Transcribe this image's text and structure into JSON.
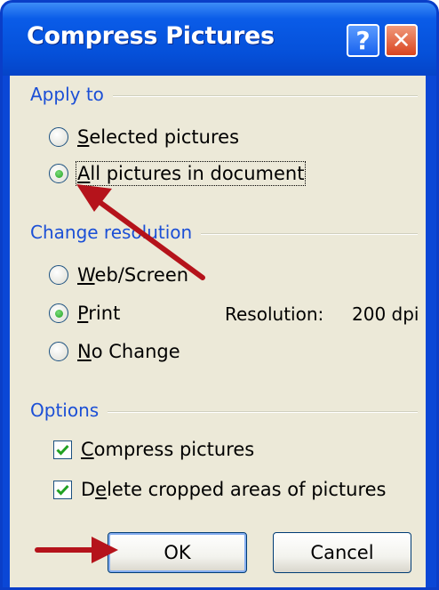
{
  "title_bar": {
    "title": "Compress Pictures",
    "help_label": "?",
    "close_label": "✕"
  },
  "apply_to": {
    "label": "Apply to",
    "options": [
      {
        "label": "Selected pictures",
        "mnemonic": "S",
        "rest": "elected pictures",
        "selected": false
      },
      {
        "label": "All pictures in document",
        "mnemonic": "A",
        "rest": "ll pictures in document",
        "selected": true
      }
    ]
  },
  "change_resolution": {
    "label": "Change resolution",
    "options": [
      {
        "label": "Web/Screen",
        "mnemonic": "W",
        "rest": "eb/Screen",
        "selected": false
      },
      {
        "label": "Print",
        "mnemonic": "P",
        "rest": "rint",
        "selected": true
      },
      {
        "label": "No Change",
        "mnemonic": "N",
        "rest": "o Change",
        "selected": false
      }
    ],
    "resolution_label": "Resolution:",
    "resolution_value": "200 dpi"
  },
  "options": {
    "label": "Options",
    "checkboxes": [
      {
        "label": "Compress pictures",
        "mnemonic": "C",
        "rest": "ompress pictures",
        "checked": true
      },
      {
        "label": "Delete cropped areas of pictures",
        "pre": "D",
        "mnemonic": "e",
        "rest": "lete cropped areas of pictures",
        "checked": true
      }
    ]
  },
  "buttons": {
    "ok": "OK",
    "cancel": "Cancel"
  },
  "colors": {
    "title_bar": "#0a5ce8",
    "group_label": "#1b4fd6",
    "annotation_arrow": "#b5131b",
    "dialog_background": "#ece9d8"
  },
  "annotations": {
    "arrow_icon": "red-arrow"
  }
}
